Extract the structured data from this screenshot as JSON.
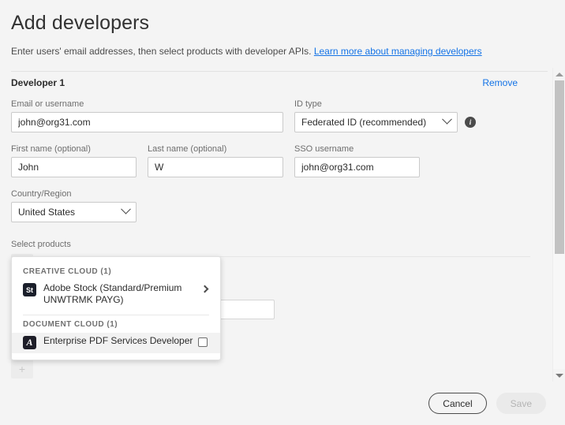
{
  "header": {
    "title": "Add developers",
    "subtitle": "Enter users' email addresses, then select products with developer APIs.",
    "link_text": "Learn more about managing developers"
  },
  "developer_section": {
    "title": "Developer 1",
    "remove_label": "Remove",
    "fields": {
      "email_label": "Email or username",
      "email_value": "john@org31.com",
      "idtype_label": "ID type",
      "idtype_value": "Federated ID (recommended)",
      "info_icon_glyph": "i",
      "firstname_label": "First name (optional)",
      "firstname_value": "John",
      "lastname_label": "Last name (optional)",
      "lastname_value": "W",
      "sso_label": "SSO username",
      "sso_value": "john@org31.com",
      "country_label": "Country/Region",
      "country_value": "United States"
    },
    "products_label": "Select products",
    "add_product_glyph": "+"
  },
  "product_popup": {
    "groups": [
      {
        "label": "CREATIVE CLOUD (1)",
        "items": [
          {
            "icon_text": "St",
            "label": "Adobe Stock (Standard/Premium UNWTRMK PAYG)",
            "affordance": "chevron"
          }
        ]
      },
      {
        "label": "DOCUMENT CLOUD (1)",
        "items": [
          {
            "icon_text": "A",
            "label": "Enterprise PDF Services Developer",
            "affordance": "checkbox"
          }
        ]
      }
    ]
  },
  "footer": {
    "cancel_label": "Cancel",
    "save_label": "Save"
  },
  "colors": {
    "link_blue": "#1473e6",
    "background": "#f4f4f4",
    "text": "#2c2c2c"
  }
}
